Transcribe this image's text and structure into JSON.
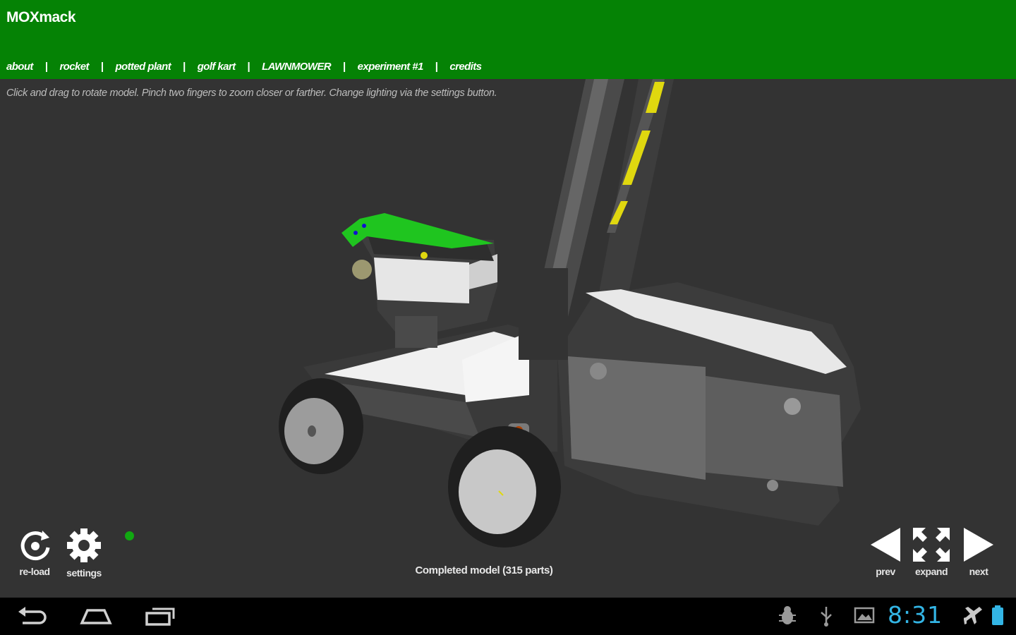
{
  "app": {
    "title": "MOXmack"
  },
  "nav": {
    "items": [
      {
        "label": "about"
      },
      {
        "label": "rocket"
      },
      {
        "label": "potted plant"
      },
      {
        "label": "golf kart"
      },
      {
        "label": "LAWNMOWER"
      },
      {
        "label": "experiment #1"
      },
      {
        "label": "credits"
      }
    ],
    "separator": "|"
  },
  "viewer": {
    "instructions": "Click and drag to rotate model. Pinch two fingers to zoom closer or farther. Change lighting via the settings button.",
    "status": "Completed model (315 parts)"
  },
  "controls": {
    "reload_label": "re-load",
    "settings_label": "settings",
    "prev_label": "prev",
    "expand_label": "expand",
    "next_label": "next"
  },
  "system": {
    "clock": "8:31",
    "icons": [
      "back-icon",
      "home-icon",
      "recent-apps-icon",
      "debug-icon",
      "usb-icon",
      "gallery-icon",
      "airplane-mode-icon",
      "battery-icon"
    ]
  },
  "colors": {
    "header": "#058205",
    "viewport": "#333333",
    "clock": "#33b5e5",
    "status_dot": "#11a811"
  }
}
